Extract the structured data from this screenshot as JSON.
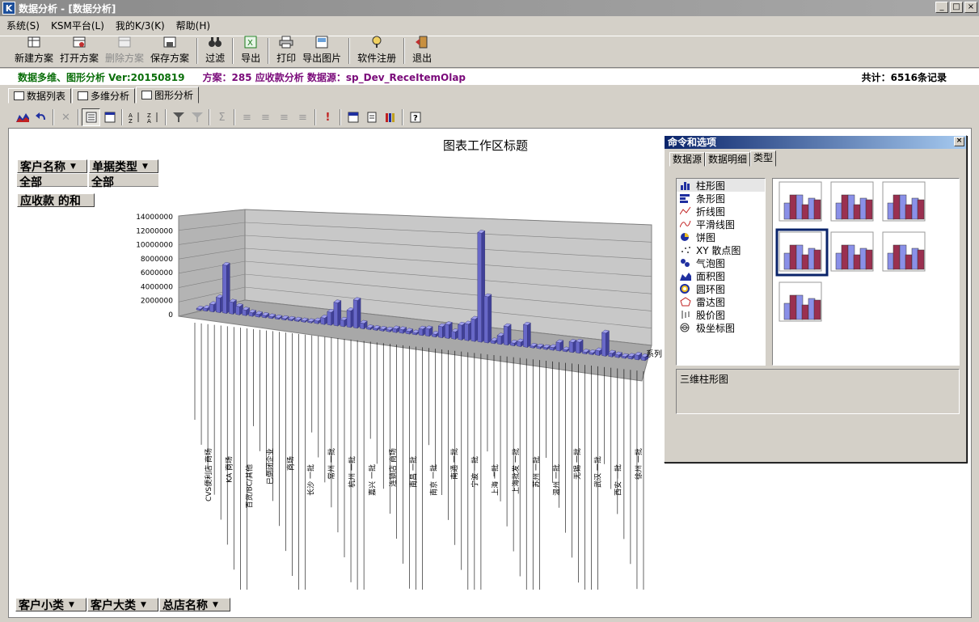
{
  "window": {
    "title": "数据分析 - [数据分析]",
    "min": "_",
    "restore": "□",
    "close": "×"
  },
  "menu": [
    "系统(S)",
    "KSM平台(L)",
    "我的K/3(K)",
    "帮助(H)"
  ],
  "toolbar": {
    "new": "新建方案",
    "open": "打开方案",
    "delete": "删除方案",
    "save": "保存方案",
    "filter": "过滤",
    "export": "导出",
    "print": "打印",
    "export_img": "导出图片",
    "register": "软件注册",
    "exit": "退出"
  },
  "info": {
    "version": "数据多维、图形分析 Ver:20150819",
    "scheme": "方案：285 应收款分析 数据源：sp_Dev_ReceItemOlap",
    "total": "共计：6516条记录"
  },
  "tabs": [
    "数据列表",
    "多维分析",
    "图形分析"
  ],
  "chart_area": {
    "title": "图表工作区标题",
    "filters": [
      {
        "name": "客户名称",
        "value": "全部"
      },
      {
        "name": "单据类型",
        "value": "全部"
      }
    ],
    "data_field": "应收款 的和",
    "row_fields": [
      "客户小类",
      "客户大类",
      "总店名称"
    ],
    "series_label": "系列"
  },
  "chart_data": {
    "type": "bar",
    "ylim": [
      0,
      14000000
    ],
    "yticks": [
      "14000000",
      "12000000",
      "10000000",
      "8000000",
      "6000000",
      "4000000",
      "2000000",
      "0"
    ],
    "values": [
      150000,
      300000,
      800000,
      1600000,
      5200000,
      1300000,
      900000,
      600000,
      400000,
      300000,
      250000,
      200000,
      150000,
      150000,
      150000,
      150000,
      150000,
      150000,
      300000,
      700000,
      1400000,
      2500000,
      700000,
      1800000,
      3000000,
      600000,
      200000,
      200000,
      200000,
      200000,
      400000,
      400000,
      300000,
      200000,
      700000,
      800000,
      300000,
      1200000,
      1500000,
      800000,
      1600000,
      1800000,
      2400000,
      11800000,
      5000000,
      300000,
      900000,
      2000000,
      300000,
      500000,
      2400000,
      200000,
      200000,
      200000,
      300000,
      900000,
      200000,
      1100000,
      1200000,
      200000,
      200000,
      500000,
      2500000,
      400000,
      300000,
      200000,
      300000,
      500000,
      400000
    ],
    "group_labels": [
      "CVS便利店 商场",
      "KA 商场",
      "百货/BC/其他",
      "已倒闭企业",
      "商场",
      "长沙 一批",
      "常州 一批",
      "杭州 一批",
      "嘉兴 一批",
      "连锁店 商场",
      "南昌 一批",
      "南京 一批",
      "南通 一批",
      "宁波 一批",
      "上海 一批",
      "上海批发 一批",
      "苏州 一批",
      "温州 一批",
      "无锡 一批",
      "武汉 一批",
      "西安 一批",
      "徐州 一批"
    ]
  },
  "dialog": {
    "title": "命令和选项",
    "close": "×",
    "tabs": [
      "数据源",
      "数据明细",
      "类型"
    ],
    "types": [
      "柱形图",
      "条形图",
      "折线图",
      "平滑线图",
      "饼图",
      "XY 散点图",
      "气泡图",
      "面积图",
      "圆环图",
      "雷达图",
      "股价图",
      "极坐标图"
    ],
    "selected_description": "三维柱形图"
  },
  "colors": {
    "bar": "#6868c8",
    "bar_top": "#a0a0ee",
    "bar_side": "#404098",
    "accent_green": "#0a6e0a",
    "accent_purple": "#7a0a7a",
    "sub_blue": "#8a90e8",
    "sub_red": "#9a3050"
  }
}
